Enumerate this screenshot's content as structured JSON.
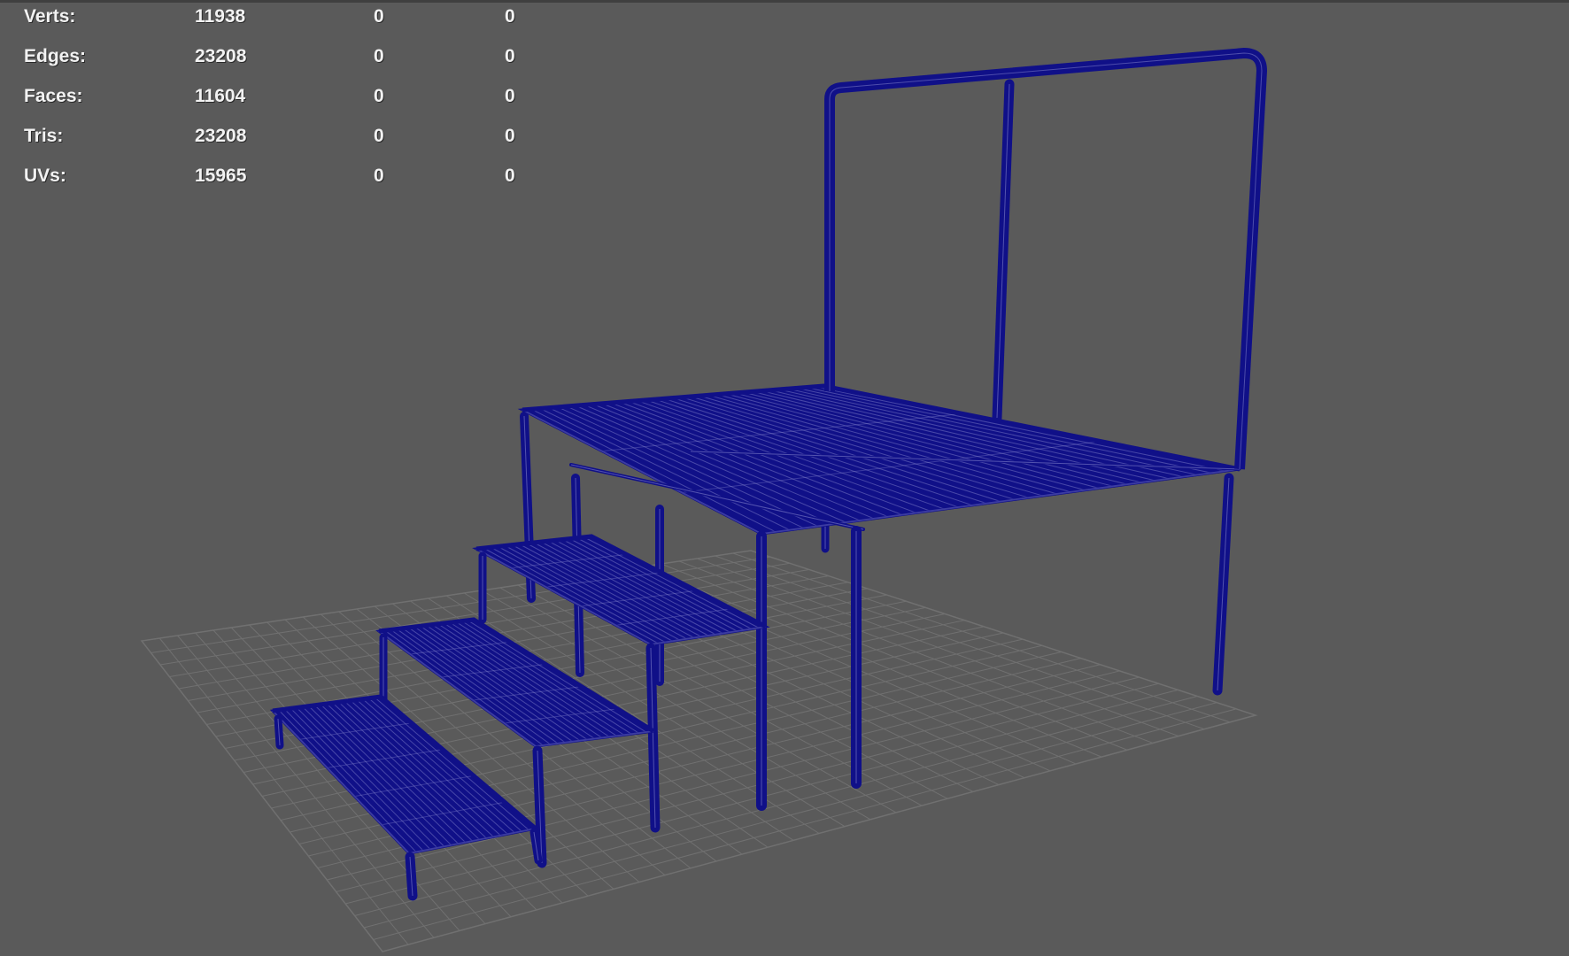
{
  "hud": {
    "rows": [
      {
        "label": "Verts:",
        "total": "11938",
        "sel1": "0",
        "sel2": "0"
      },
      {
        "label": "Edges:",
        "total": "23208",
        "sel1": "0",
        "sel2": "0"
      },
      {
        "label": "Faces:",
        "total": "11604",
        "sel1": "0",
        "sel2": "0"
      },
      {
        "label": "Tris:",
        "total": "23208",
        "sel1": "0",
        "sel2": "0"
      },
      {
        "label": "UVs:",
        "total": "15965",
        "sel1": "0",
        "sel2": "0"
      }
    ]
  },
  "colors": {
    "background": "#5a5a5a",
    "grid": "#707070",
    "wireframe": "#101088",
    "wireframe_highlight": "#8a8ad0",
    "hud_text": "#f2f2f2"
  }
}
